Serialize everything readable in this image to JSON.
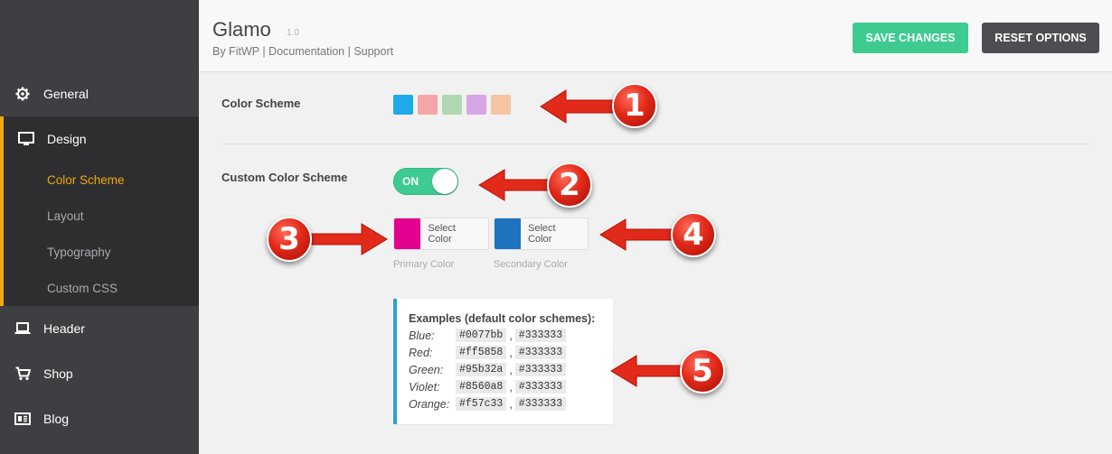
{
  "app": {
    "title": "Glamo",
    "version": "1.0",
    "links": "By FitWP | Documentation | Support"
  },
  "toolbar": {
    "save_label": "SAVE CHANGES",
    "reset_label": "RESET OPTIONS"
  },
  "sidebar": {
    "items": [
      {
        "label": "General",
        "icon": "gear-icon"
      },
      {
        "label": "Design",
        "icon": "monitor-icon"
      },
      {
        "label": "Header",
        "icon": "laptop-icon"
      },
      {
        "label": "Shop",
        "icon": "cart-icon"
      },
      {
        "label": "Blog",
        "icon": "newspaper-icon"
      }
    ],
    "design_submenu": [
      {
        "label": "Color Scheme",
        "active": true
      },
      {
        "label": "Layout"
      },
      {
        "label": "Typography"
      },
      {
        "label": "Custom CSS"
      }
    ]
  },
  "color_scheme": {
    "label": "Color Scheme",
    "swatches": [
      "#1ea9e9",
      "#f4a6a6",
      "#b1d8b1",
      "#d5a5e5",
      "#f5c5a3"
    ]
  },
  "custom_color_scheme": {
    "label": "Custom Color Scheme",
    "toggle_text": "ON",
    "primary": {
      "color": "#e4008e",
      "button": "Select Color",
      "caption": "Primary Color"
    },
    "secondary": {
      "color": "#1e73be",
      "button": "Select Color",
      "caption": "Secondary Color"
    }
  },
  "examples": {
    "title": "Examples (default color schemes):",
    "rows": [
      {
        "name": "Blue:",
        "c1": "#0077bb",
        "c2": "#333333"
      },
      {
        "name": "Red:",
        "c1": "#ff5858",
        "c2": "#333333"
      },
      {
        "name": "Green:",
        "c1": "#95b32a",
        "c2": "#333333"
      },
      {
        "name": "Violet:",
        "c1": "#8560a8",
        "c2": "#333333"
      },
      {
        "name": "Orange:",
        "c1": "#f57c33",
        "c2": "#333333"
      }
    ]
  },
  "annotations": {
    "n1": "1",
    "n2": "2",
    "n3": "3",
    "n4": "4",
    "n5": "5",
    "color": "#e22a1a"
  },
  "colors": {
    "accent": "#f0a80c",
    "save": "#3ecb92",
    "reset": "#4e4e52",
    "sidebar": "#3f3f43"
  }
}
